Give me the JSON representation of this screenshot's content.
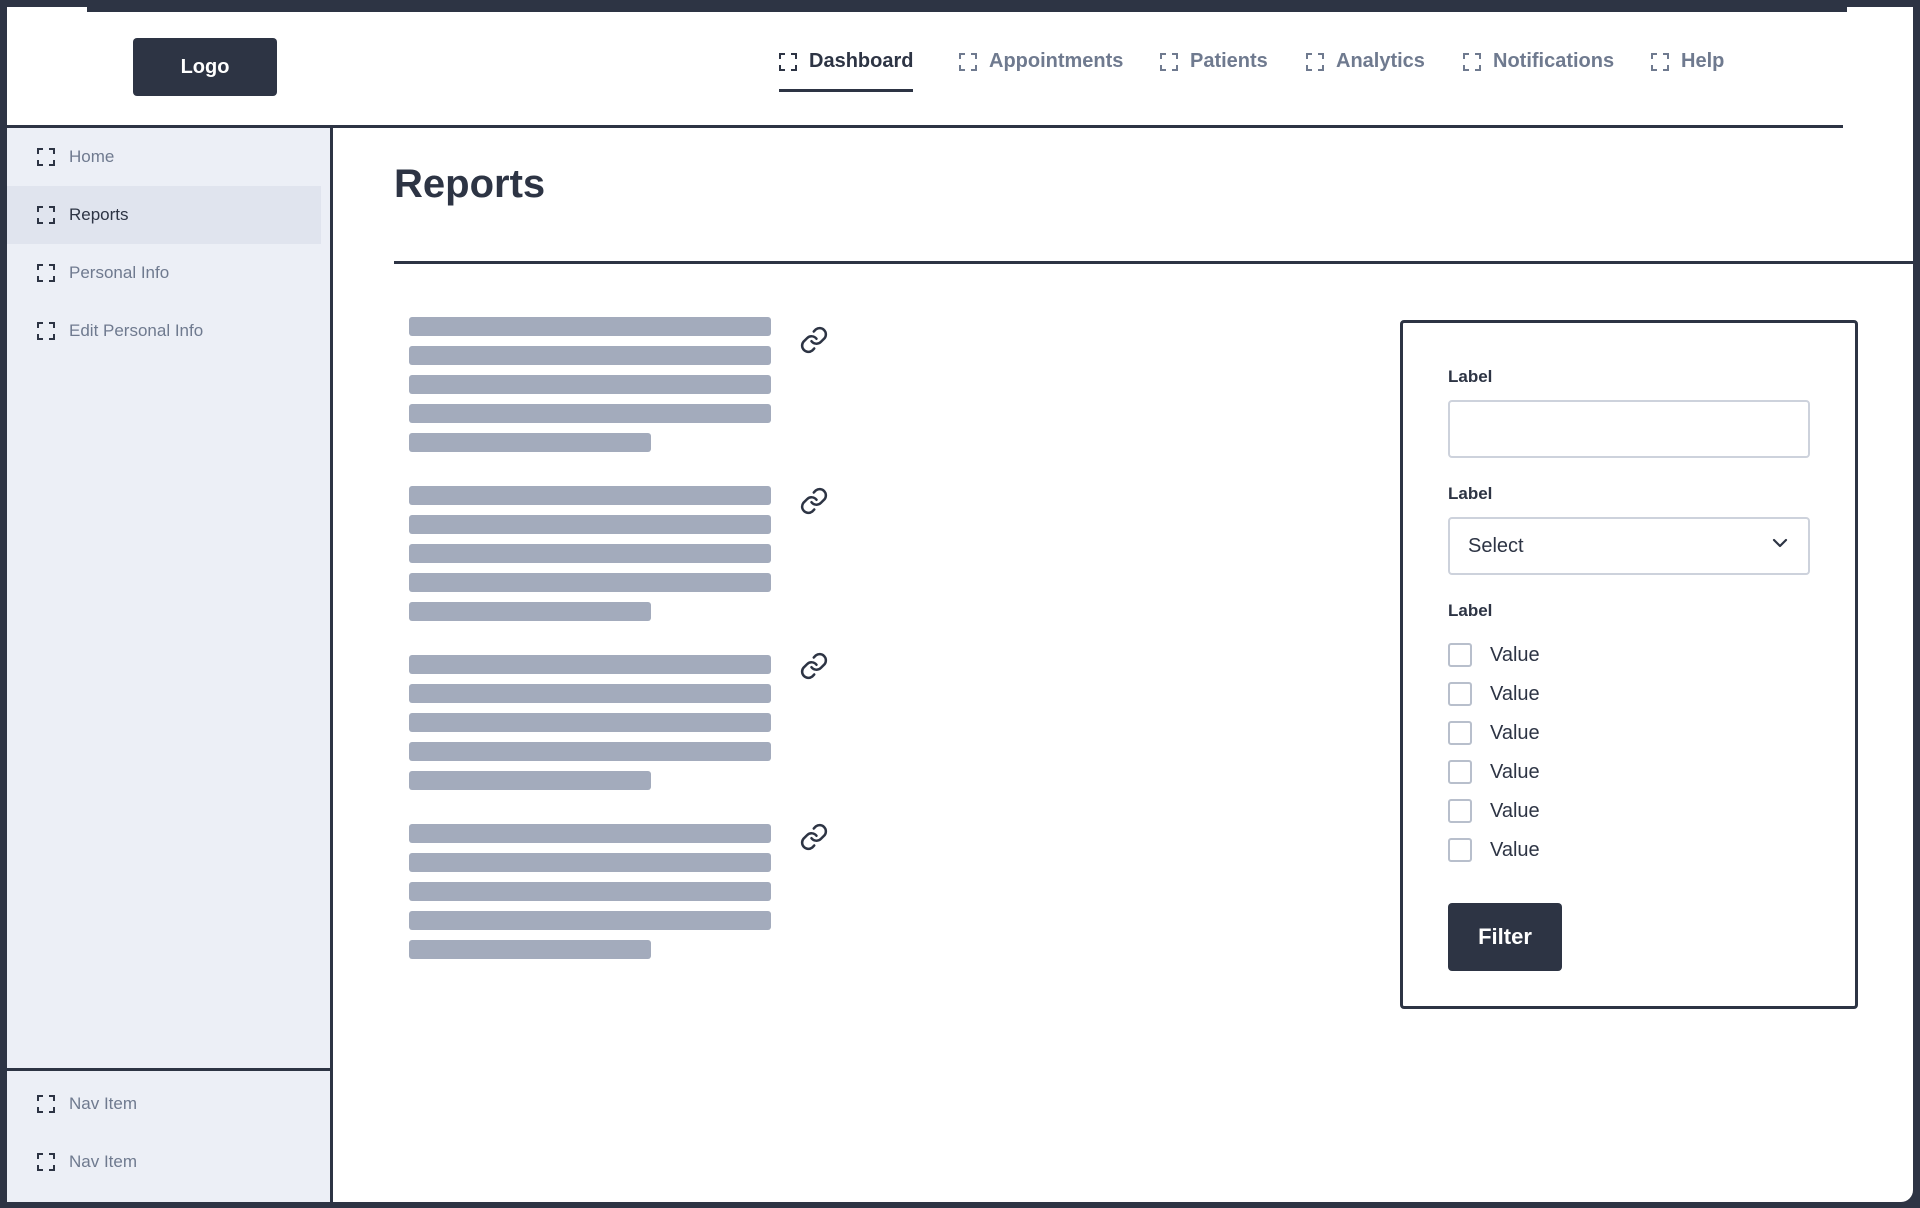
{
  "header": {
    "logo": "Logo",
    "nav": [
      {
        "label": "Dashboard",
        "active": true
      },
      {
        "label": "Appointments",
        "active": false
      },
      {
        "label": "Patients",
        "active": false
      },
      {
        "label": "Analytics",
        "active": false
      },
      {
        "label": "Notifications",
        "active": false
      },
      {
        "label": "Help",
        "active": false
      }
    ]
  },
  "sidebar": {
    "items": [
      {
        "label": "Home",
        "active": false
      },
      {
        "label": "Reports",
        "active": true
      },
      {
        "label": "Personal Info",
        "active": false
      },
      {
        "label": "Edit Personal Info",
        "active": false
      }
    ],
    "footer_items": [
      {
        "label": "Nav Item"
      },
      {
        "label": "Nav Item"
      }
    ]
  },
  "main": {
    "title": "Reports",
    "cards_count_note": "4 placeholder text blocks with link icons",
    "link_icon": "link-icon"
  },
  "filter": {
    "text_field_label": "Label",
    "select_label": "Label",
    "select_value": "Select",
    "checkbox_group_label": "Label",
    "checkboxes": [
      "Value",
      "Value",
      "Value",
      "Value",
      "Value",
      "Value"
    ],
    "button_label": "Filter"
  },
  "colors": {
    "primary": "#2d3444",
    "muted_text": "#6f7a8f",
    "sidebar_bg": "#eceff6",
    "skeleton": "#a3abbc"
  }
}
